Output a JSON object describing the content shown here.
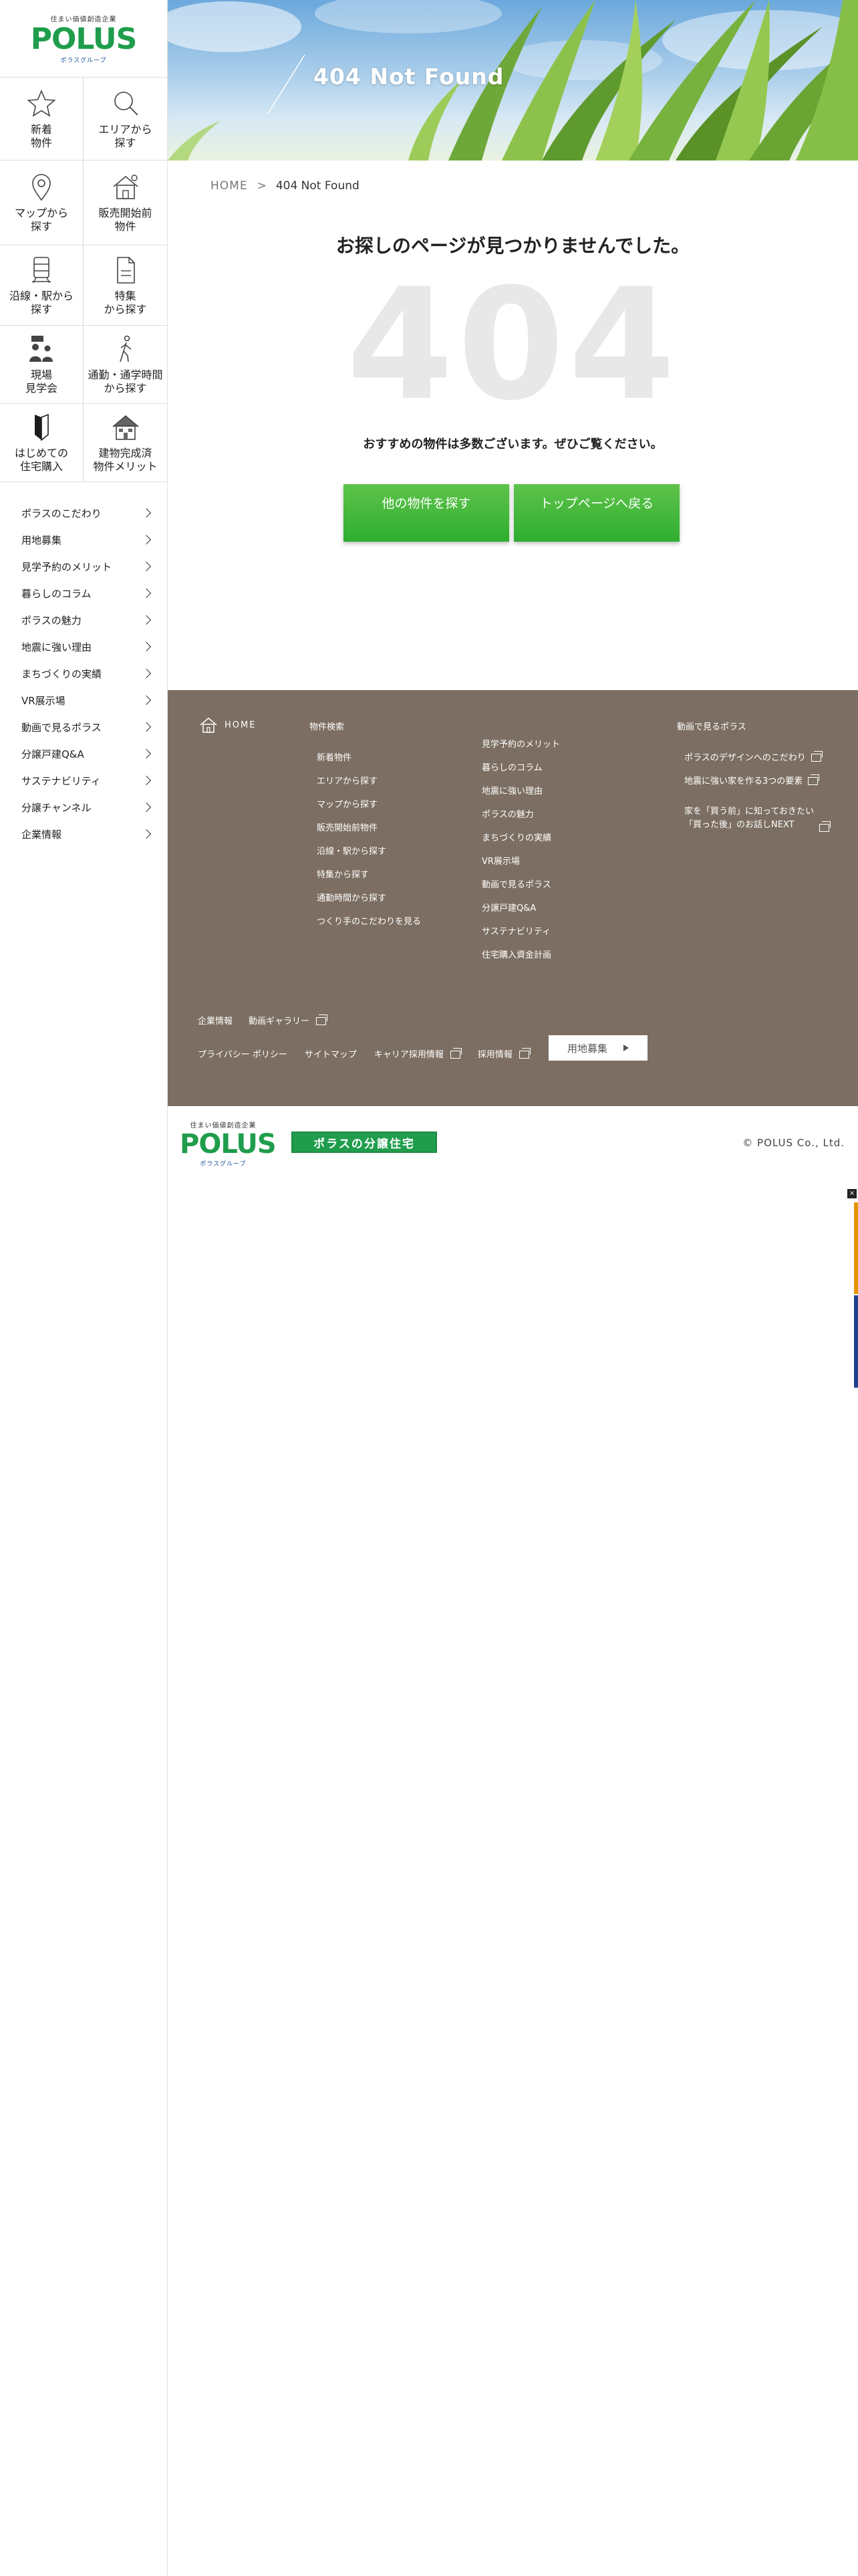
{
  "sidebar": {
    "logo": {
      "tagline": "住まい価値創造企業",
      "name": "POLUS",
      "sub": "ポラスグループ"
    },
    "tiles": [
      {
        "label": "新着\n物件",
        "icon": "star-icon"
      },
      {
        "label": "エリアから\n探す",
        "icon": "search-icon"
      },
      {
        "label": "マップから\n探す",
        "icon": "map-pin-icon"
      },
      {
        "label": "販売開始前\n物件",
        "icon": "house-icon"
      },
      {
        "label": "沿線・駅から\n探す",
        "icon": "train-icon"
      },
      {
        "label": "特集\nから探す",
        "icon": "document-icon"
      },
      {
        "label": "現場\n見学会",
        "icon": "people-icon"
      },
      {
        "label": "通勤・通学時間\nから探す",
        "icon": "walking-person-icon"
      },
      {
        "label": "はじめての\n住宅購入",
        "icon": "beginner-mark-icon"
      },
      {
        "label": "建物完成済\n物件メリット",
        "icon": "completed-house-icon"
      }
    ],
    "menu": [
      "ポラスのこだわり",
      "用地募集",
      "見学予約のメリット",
      "暮らしのコラム",
      "ポラスの魅力",
      "地震に強い理由",
      "まちづくりの実績",
      "VR展示場",
      "動画で見るポラス",
      "分譲戸建Q&A",
      "サステナビリティ",
      "分譲チャンネル",
      "企業情報"
    ]
  },
  "hero": {
    "title": "404 Not Found"
  },
  "breadcrumb": {
    "home": "HOME",
    "separator": ">",
    "current": "404 Not Found"
  },
  "main": {
    "heading": "お探しのページが見つかりませんでした。",
    "code": "404",
    "subtext": "おすすめの物件は多数ございます。ぜひご覧ください。",
    "buttons": {
      "other": "他の物件を探す",
      "top": "トップページへ戻る"
    }
  },
  "footer": {
    "home": "HOME",
    "search_heading": "物件検索",
    "search_links": [
      "新着物件",
      "エリアから探す",
      "マップから探す",
      "販売開始前物件",
      "沿線・駅から探す",
      "特集から探す",
      "通勤時間から探す",
      "つくり手のこだわりを見る"
    ],
    "middle_links": [
      "見学予約のメリット",
      "暮らしのコラム",
      "地震に強い理由",
      "ポラスの魅力",
      "まちづくりの実績",
      "VR展示場",
      "動画で見るポラス",
      "分譲戸建Q&A",
      "サステナビリティ",
      "住宅購入資金計画"
    ],
    "video_heading": "動画で見るポラス",
    "video_links": [
      "ポラスのデザインへのこだわり",
      "地震に強い家を作る3つの要素",
      "家を「買う前」に知っておきたい\n「買った後」のお話しNEXT"
    ],
    "bottom_row1": [
      "企業情報",
      "動画ギャラリー"
    ],
    "bottom_row2": [
      "プライバシー ポリシー",
      "サイトマップ",
      "キャリア採用情報",
      "採用情報"
    ],
    "recruit_button": "用地募集"
  },
  "band": {
    "logo": {
      "tagline": "住まい価値創造企業",
      "name": "POLUS",
      "sub": "ポラスグループ"
    },
    "brand2": "ポラスの分譲住宅",
    "copyright": "© POLUS Co., Ltd."
  },
  "floating": {
    "close": "×"
  },
  "colors": {
    "accent_green": "#2fae2f",
    "footer_brown": "#7c6e62",
    "logo_green": "#1f9d4c",
    "logo_blue": "#1d4e9a",
    "logo_orange": "#ef8f00"
  }
}
